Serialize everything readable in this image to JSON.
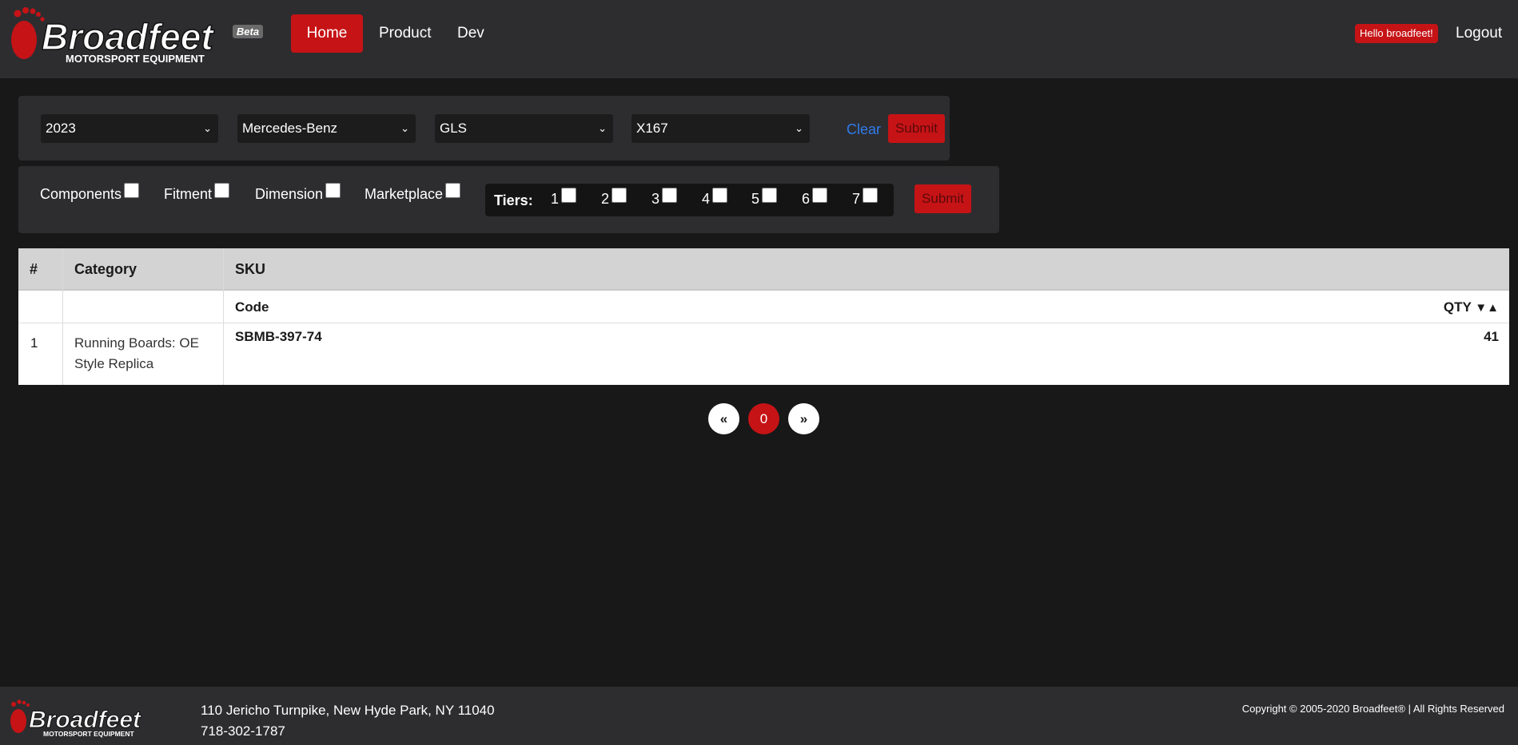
{
  "header": {
    "brand_name": "Broadfeet",
    "brand_tagline": "MOTORSPORT EQUIPMENT",
    "beta_badge": "Beta",
    "nav": [
      {
        "label": "Home"
      },
      {
        "label": "Product"
      },
      {
        "label": "Dev"
      }
    ],
    "greeting": "Hello broadfeet!",
    "logout_label": "Logout"
  },
  "vehicle_filter": {
    "year": "2023",
    "make": "Mercedes-Benz",
    "model": "GLS",
    "chassis": "X167",
    "clear_label": "Clear",
    "submit_label": "Submit"
  },
  "options_filter": {
    "checkboxes": [
      {
        "label": "Components",
        "checked": false
      },
      {
        "label": "Fitment",
        "checked": false
      },
      {
        "label": "Dimension",
        "checked": false
      },
      {
        "label": "Marketplace",
        "checked": false
      }
    ],
    "tiers_label": "Tiers:",
    "tiers": [
      "1",
      "2",
      "3",
      "4",
      "5",
      "6",
      "7"
    ],
    "submit_label": "Submit"
  },
  "table": {
    "headers": {
      "num": "#",
      "category": "Category",
      "sku": "SKU"
    },
    "sub_headers": {
      "code": "Code",
      "qty": "QTY",
      "sort_icons": "▼▲"
    },
    "rows": [
      {
        "num": "1",
        "category": "Running Boards: OE Style Replica",
        "code": "SBMB-397-74",
        "qty": "41"
      }
    ]
  },
  "pagination": {
    "prev": "«",
    "current": "0",
    "next": "»"
  },
  "footer": {
    "address": "110 Jericho Turnpike, New Hyde Park, NY 11040",
    "phone": "718-302-1787",
    "copyright": "Copyright © 2005-2020 Broadfeet® | All Rights Reserved"
  },
  "colors": {
    "accent": "#c61316",
    "nav_bg": "#2d2d30",
    "page_bg": "#181818",
    "link": "#2f7bea"
  }
}
